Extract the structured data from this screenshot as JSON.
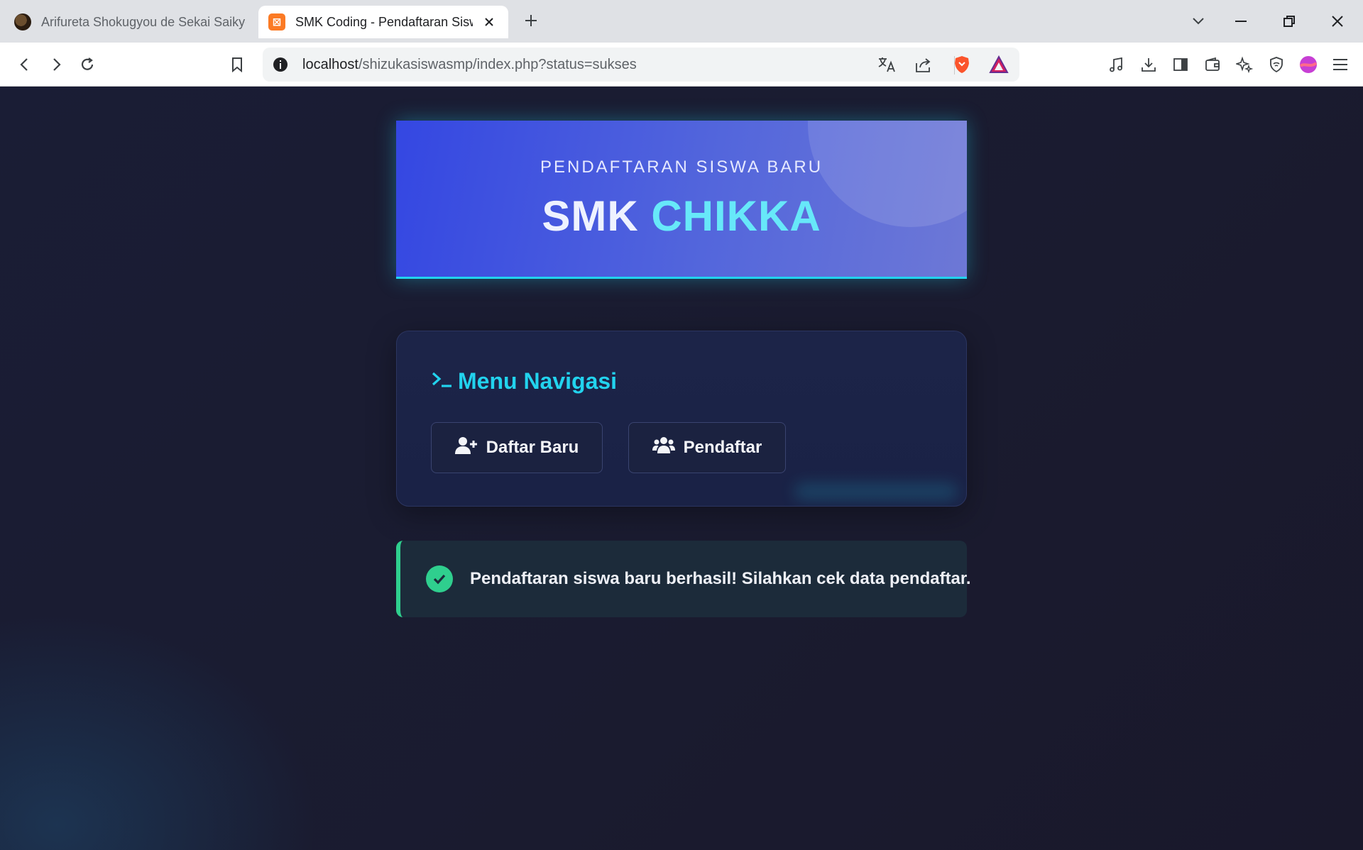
{
  "browser": {
    "tabs": [
      {
        "title": "Arifureta Shokugyou de Sekai Saikyou"
      },
      {
        "title": "SMK Coding - Pendaftaran Siswa Baru",
        "active": true
      }
    ],
    "address": {
      "host": "localhost",
      "path": "/shizukasiswasmp/index.php?status=sukses"
    }
  },
  "hero": {
    "subtitle": "PENDAFTARAN SISWA BARU",
    "title_word1": "SMK",
    "title_word2": "CHIKKA"
  },
  "nav": {
    "heading": "Menu Navigasi",
    "buttons": [
      {
        "label": "Daftar Baru",
        "icon": "user-plus-icon"
      },
      {
        "label": "Pendaftar",
        "icon": "users-icon"
      }
    ]
  },
  "alert": {
    "message": "Pendaftaran siswa baru berhasil! Silahkan cek data pendaftar.",
    "icon": "check-circle-icon",
    "color": "#2fcf8e"
  },
  "colors": {
    "accent": "#22d3ee",
    "hero": "#3447e2",
    "background": "#1a1b2e"
  }
}
